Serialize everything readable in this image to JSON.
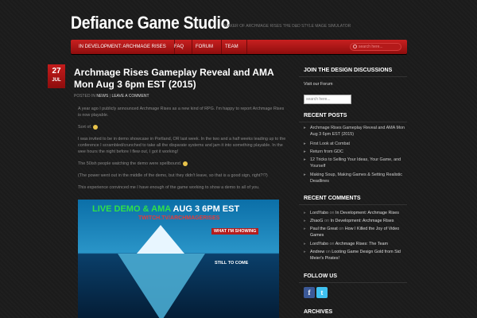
{
  "site": {
    "title": "Defiance Game Studio",
    "tagline": "Maker of Archmage Rises the D&D style mage simulator"
  },
  "nav": {
    "items": [
      "In Development: Archmage Rises",
      "FAQ",
      "Forum",
      "Team"
    ],
    "search_placeholder": "search here..."
  },
  "post": {
    "date_day": "27",
    "date_month": "Jul",
    "title": "Archmage Rises Gameplay Reveal and AMA Mon Aug 3 6pm EST (2015)",
    "meta_prefix": "Posted in",
    "meta_category": "News",
    "meta_sep": "|",
    "meta_comment": "Leave a Comment",
    "paragraphs": [
      "A year ago I publicly announced Archmage Rises as a new kind of RPG.  I'm happy to report Archmage Rises is now playable.",
      "Sort of.",
      "I was invited to be in demo showcase in Portland, OR last week.  In the two and a half weeks leading up to the conference I scrambled/crunched to take all the disparate systems and jam it into something playable.  In the wee hours the night before I flew out, I got it working!",
      "The 50ish people watching the demo were spellbound.",
      "(The power went out in the middle of the demo, but they didn't leave, so that is a good sign, right?!?)",
      "This experience convinced me I have enough of the game working to show a demo to all of you."
    ],
    "promo": {
      "line1_a": "LIVE DEMO & AMA ",
      "line1_b": "AUG 3 6PM EST",
      "line2": "TWITCH.TV/ARCHMAGERISES",
      "showing": "WHAT I'M SHOWING",
      "still": "STILL TO COME"
    }
  },
  "sidebar": {
    "discussion_title": "Join the Design Discussions",
    "forum_link": "Visit our Forum",
    "search_placeholder": "search here...",
    "recent_posts_title": "Recent Posts",
    "recent_posts": [
      "Archmage Rises Gameplay Reveal and AMA Mon Aug 3 6pm EST (2015)",
      "First Look at Combat",
      "Return from GDC",
      "12 Tricks to Selling Your Ideas, Your Game, and Yourself",
      "Making Soup, Making Games & Setting Realistic Deadlines"
    ],
    "recent_comments_title": "Recent Comments",
    "recent_comments": [
      {
        "author": "LordYabo",
        "on": "on",
        "post": "In Development: Archmage Rises"
      },
      {
        "author": "ZhaoG",
        "on": "on",
        "post": "In Development: Archmage Rises"
      },
      {
        "author": "Paul the Great",
        "on": "on",
        "post": "How I Killed the Joy of Video Games"
      },
      {
        "author": "LordYabo",
        "on": "on",
        "post": "Archmage Rises: The Team"
      },
      {
        "author": "Andrew",
        "on": "on",
        "post": "Looting Game Design Gold from Sid Meier's Pirates!"
      }
    ],
    "follow_title": "Follow Us",
    "archives_title": "Archives"
  }
}
